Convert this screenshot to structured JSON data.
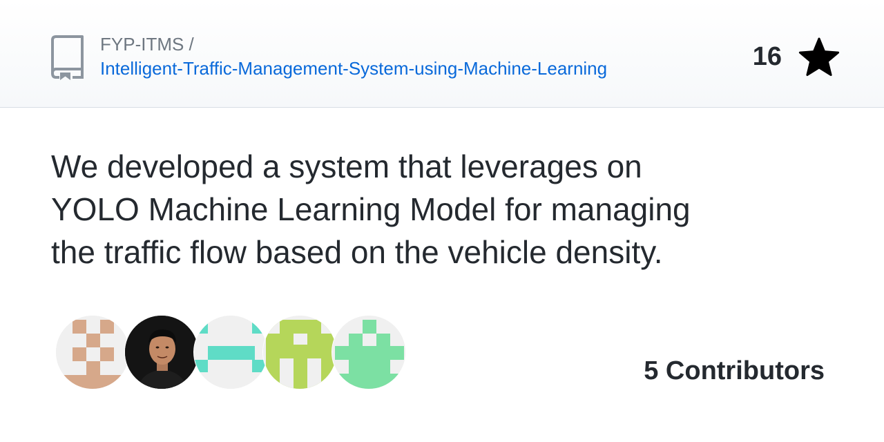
{
  "repo": {
    "owner_label": "FYP-ITMS /",
    "name": "Intelligent-Traffic-Management-System-using-Machine-Learning",
    "stars": "16",
    "description": "We developed a system that leverages on YOLO Machine Learning Model for managing the traffic flow based on the vehicle density."
  },
  "contributors": {
    "label": "5 Contributors",
    "avatars": [
      {
        "name": "identicon-avatar-1",
        "color": "#d6a88a"
      },
      {
        "name": "photo-avatar-2",
        "color": "#111111"
      },
      {
        "name": "identicon-avatar-3",
        "color": "#5fdcc6"
      },
      {
        "name": "identicon-avatar-4",
        "color": "#b5d65a"
      },
      {
        "name": "identicon-avatar-5",
        "color": "#7ce0a3"
      }
    ]
  },
  "colors": {
    "link": "#0969da",
    "text": "#24292f",
    "muted": "#6e7781"
  },
  "icons": {
    "repo": "repo-icon",
    "star": "star-icon"
  }
}
